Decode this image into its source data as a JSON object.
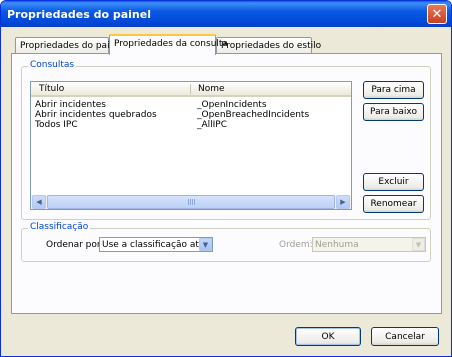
{
  "window": {
    "title": "Propriedades do painel",
    "close_glyph": "✕"
  },
  "tabs": [
    {
      "label": "Propriedades do painel",
      "active": false
    },
    {
      "label": "Propriedades da consulta",
      "active": true
    },
    {
      "label": "Propriedades do estilo",
      "active": false
    }
  ],
  "consultas": {
    "group_label": "Consultas",
    "columns": [
      "Título",
      "Nome"
    ],
    "rows": [
      {
        "titulo": "Abrir incidentes",
        "nome": "_OpenIncidents"
      },
      {
        "titulo": "Abrir incidentes quebrados",
        "nome": "_OpenBreachedIncidents"
      },
      {
        "titulo": "Todos IPC",
        "nome": "_AllIPC"
      }
    ],
    "buttons": {
      "move_up": "Para cima",
      "move_down": "Para baixo",
      "delete": "Excluir",
      "rename": "Renomear"
    },
    "scroll_left_glyph": "◀",
    "scroll_right_glyph": "▶"
  },
  "classificacao": {
    "group_label": "Classificação",
    "sort_by_label": "Ordenar por:",
    "sort_by_value": "Use a classificação atual",
    "order_label": "Ordem:",
    "order_value": "Nenhuma",
    "dropdown_glyph": "▼"
  },
  "footer": {
    "ok": "OK",
    "cancel": "Cancelar"
  },
  "colors": {
    "title_bar": "#0a59e3",
    "group_label": "#0046d5",
    "window_bg": "#ece9d8"
  }
}
